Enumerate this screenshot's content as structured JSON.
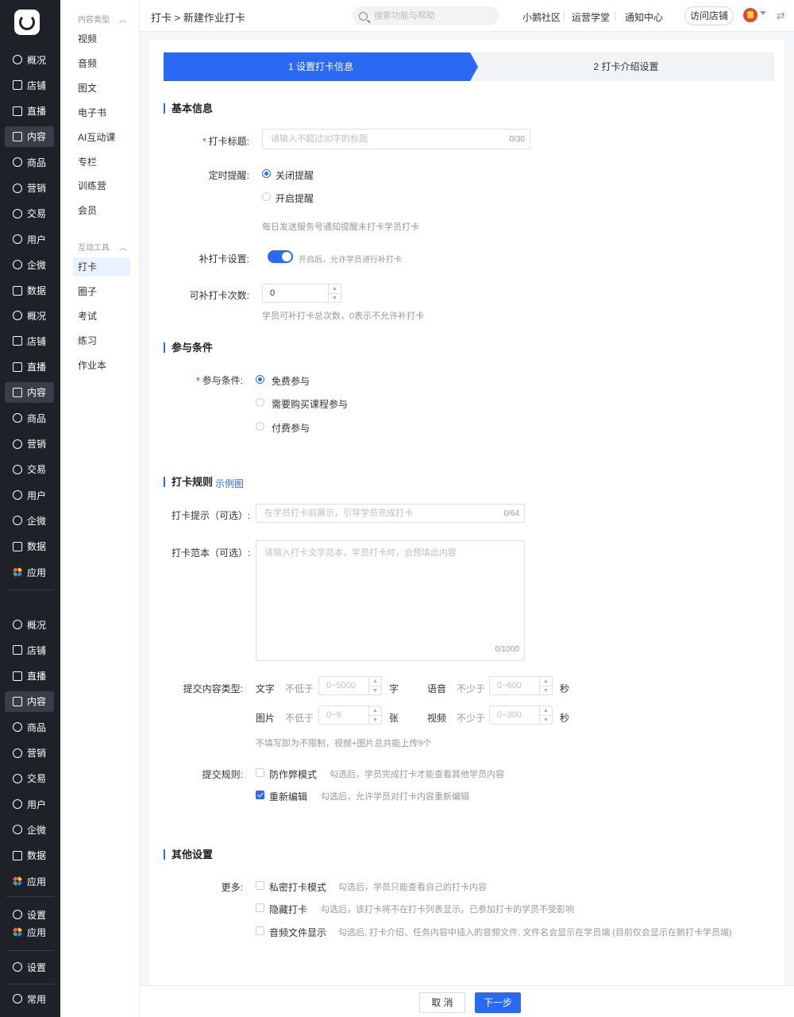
{
  "nav": {
    "groups": [
      [
        "概况",
        "店铺",
        "直播",
        "内容",
        "商品",
        "营销",
        "交易",
        "用户",
        "企微",
        "数据"
      ],
      [
        "概况",
        "店铺",
        "直播",
        "内容",
        "商品",
        "营销",
        "交易",
        "用户",
        "企微",
        "数据",
        "应用"
      ],
      [
        "概况",
        "店铺",
        "直播",
        "内容",
        "商品",
        "营销",
        "交易",
        "用户",
        "企微",
        "数据",
        "应用"
      ]
    ],
    "bottom": [
      "设置",
      "应用",
      "设置",
      "常用"
    ]
  },
  "sub": {
    "group1_title": "内容类型",
    "group1_items": [
      "视频",
      "音频",
      "图文",
      "电子书",
      "AI互动课",
      "专栏",
      "训练营",
      "会员"
    ],
    "group2_title": "互动工具",
    "group2_items": [
      "打卡",
      "圈子",
      "考试",
      "练习",
      "作业本"
    ]
  },
  "header": {
    "breadcrumb": "打卡 > 新建作业打卡",
    "search_placeholder": "搜索功能与帮助",
    "links": [
      "小鹅社区",
      "运营学堂",
      "通知中心"
    ],
    "visit_store": "访问店铺"
  },
  "steps": [
    "1 设置打卡信息",
    "2 打卡介绍设置"
  ],
  "basic": {
    "title": "基本信息",
    "title_label": "打卡标题:",
    "title_placeholder": "请输入不超过30字的标题",
    "title_count": "0/30",
    "remind_label": "定时提醒:",
    "remind_off": "关闭提醒",
    "remind_on": "开启提醒",
    "remind_hint": "每日发送服务号通知提醒未打卡学员打卡",
    "makeup_label": "补打卡设置:",
    "makeup_hint": "开启后，允许学员进行补打卡",
    "times_label": "可补打卡次数:",
    "times_value": "0",
    "times_hint": "学员可补打卡总次数，0表示不允许补打卡"
  },
  "join": {
    "title": "参与条件",
    "label": "参与条件:",
    "options": [
      "免费参与",
      "需要购买课程参与",
      "付费参与"
    ]
  },
  "rules": {
    "title": "打卡规则",
    "example_link": "示例图",
    "tip_label": "打卡提示（可选）:",
    "tip_placeholder": "在学员打卡前展示，引导学员完成打卡",
    "tip_count": "0/64",
    "sample_label": "打卡范本（可选）:",
    "sample_placeholder": "请输入打卡文字范本，学员打卡时，会预填此内容",
    "sample_count": "0/1000",
    "content_type_label": "提交内容类型:",
    "text_label": "文字",
    "text_cond": "不低于",
    "text_ph": "0~5000",
    "text_unit": "字",
    "voice_label": "语音",
    "voice_cond": "不少于",
    "voice_ph": "0~600",
    "voice_unit": "秒",
    "image_label": "图片",
    "image_cond": "不低于",
    "image_ph": "0~9",
    "image_unit": "张",
    "video_label": "视频",
    "video_cond": "不少于",
    "video_ph": "0~300",
    "video_unit": "秒",
    "content_hint": "不填写即为不限制，视频+图片总共能上传9个",
    "submit_label": "提交规则:",
    "anti_cheat": "防作弊模式",
    "anti_cheat_hint": "勾选后，学员完成打卡才能查看其他学员内容",
    "reedit": "重新编辑",
    "reedit_hint": "勾选后，允许学员对打卡内容重新编辑"
  },
  "other": {
    "title": "其他设置",
    "more_label": "更多:",
    "private": "私密打卡模式",
    "private_hint": "勾选后，学员只能查看自己的打卡内容",
    "hide": "隐藏打卡",
    "hide_hint": "勾选后，该打卡将不在打卡列表显示。已参加打卡的学员不受影响",
    "audio": "音频文件显示",
    "audio_hint": "勾选后, 打卡介绍、任务内容中插入的音频文件, 文件名会显示在学员端 (目前仅会显示在鹅打卡学员端)"
  },
  "footer": {
    "cancel": "取 消",
    "next": "下一步"
  },
  "colors": {
    "primary": "#2a6af3",
    "nav_bg": "#1f2129"
  }
}
